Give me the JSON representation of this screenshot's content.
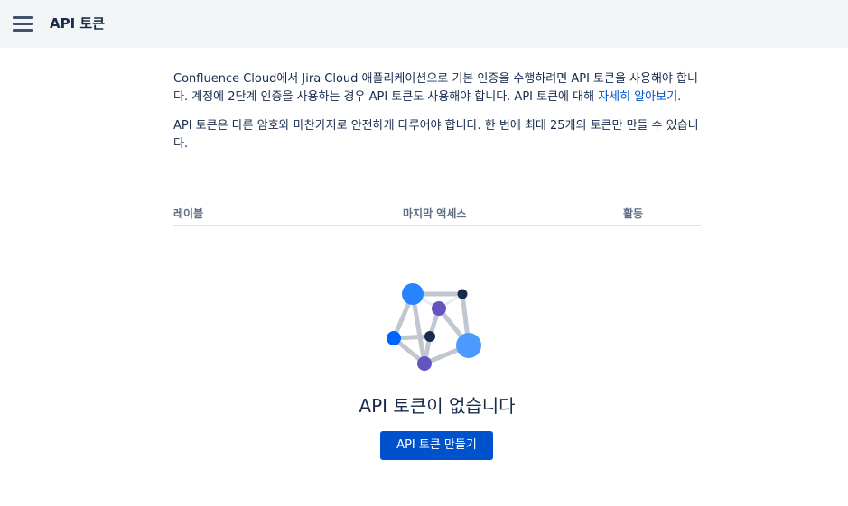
{
  "header": {
    "title": "API 토큰",
    "menu_icon": "hamburger-menu-icon"
  },
  "intro": {
    "para1_text": "Confluence Cloud에서 Jira Cloud 애플리케이션으로 기본 인증을 수행하려면 API 토큰을 사용해야 합니다. 계정에 2단계 인증을 사용하는 경우 API 토큰도 사용해야 합니다. API 토큰에 대해 ",
    "para1_link": "자세히 알아보기",
    "para1_end": ".",
    "para2_text": "API 토큰은 다른 암호와 마찬가지로 안전하게 다루어야 합니다. 한 번에 최대 25개의 토큰만 만들 수 있습니다."
  },
  "table": {
    "columns": [
      "레이블",
      "마지막 액세스",
      "활동"
    ]
  },
  "empty_state": {
    "illustration_icon": "network-nodes-icon",
    "title": "API 토큰이 없습니다",
    "button_label": "API 토큰 만들기"
  },
  "colors": {
    "brand_blue": "#0052CC",
    "header_bg": "#F4F5F7",
    "text": "#172B4D",
    "muted": "#5E6C84"
  }
}
